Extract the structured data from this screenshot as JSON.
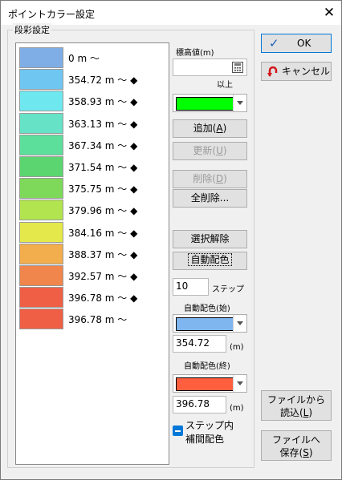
{
  "window": {
    "title": "ポイントカラー設定"
  },
  "group": {
    "label": "段彩設定"
  },
  "rows": [
    {
      "color": "#7faee6",
      "text": "0 m 〜"
    },
    {
      "color": "#6fc6f0",
      "text": "354.72 m 〜 ◆"
    },
    {
      "color": "#6ee8ee",
      "text": "358.93 m 〜 ◆"
    },
    {
      "color": "#66e2c6",
      "text": "363.13 m 〜 ◆"
    },
    {
      "color": "#5ddf9c",
      "text": "367.34 m 〜 ◆"
    },
    {
      "color": "#5bd56f",
      "text": "371.54 m 〜 ◆"
    },
    {
      "color": "#7ed85a",
      "text": "375.75 m 〜 ◆"
    },
    {
      "color": "#b2e450",
      "text": "379.96 m 〜 ◆"
    },
    {
      "color": "#e5e84a",
      "text": "384.16 m 〜 ◆"
    },
    {
      "color": "#f2ad4c",
      "text": "388.37 m 〜 ◆"
    },
    {
      "color": "#f0864b",
      "text": "392.57 m 〜 ◆"
    },
    {
      "color": "#ef5f46",
      "text": "396.78 m 〜 ◆"
    },
    {
      "color": "#ef5f46",
      "text": "396.78 m 〜"
    }
  ],
  "elevation": {
    "label": "標高値(m)",
    "value": "",
    "suffix": "以上"
  },
  "current_color": "#00ff00",
  "buttons": {
    "add": "追加(A)",
    "update": "更新(U)",
    "delete": "削除(D)",
    "delete_all": "全削除...",
    "deselect": "選択解除",
    "auto_color": "自動配色",
    "ok": "OK",
    "cancel": "キャンセル",
    "load": "ファイルから\n読込(L)",
    "save": "ファイルへ\n保存(S)"
  },
  "steps": {
    "value": "10",
    "label": "ステップ"
  },
  "auto_start": {
    "label": "自動配色(始)",
    "color": "#7fb6ef",
    "value": "354.72",
    "unit": "(m)"
  },
  "auto_end": {
    "label": "自動配色(終)",
    "color": "#ff5f3f",
    "value": "396.78",
    "unit": "(m)"
  },
  "interp": {
    "label": "ステップ内\n補間配色",
    "checked": "indeterminate"
  },
  "icons": {
    "ok": "checkmark-icon",
    "cancel": "undo-arrow-icon",
    "calc": "calculator-icon"
  }
}
